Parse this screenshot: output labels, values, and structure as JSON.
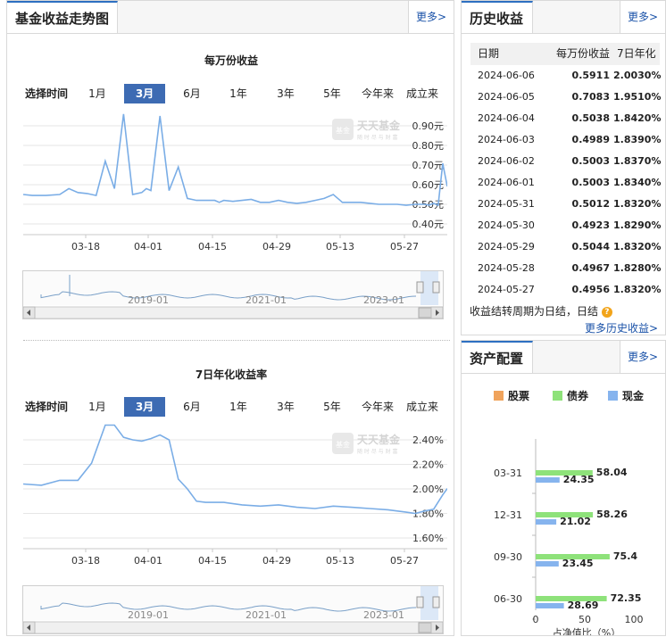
{
  "left": {
    "title": "基金收益走势图",
    "more": "更多>",
    "range_label": "选择时间",
    "ranges": [
      "1月",
      "3月",
      "6月",
      "1年",
      "3年",
      "5年",
      "今年来",
      "成立来"
    ],
    "selected_range": "3月",
    "watermark": {
      "name": "天天基金",
      "sub": "随 时 尽 与 财 富",
      "badge": "基金"
    },
    "nav_years": [
      "2019-01",
      "2021-01",
      "2023-01"
    ],
    "chart1_title": "每万份收益",
    "chart2_title": "7日年化收益率"
  },
  "history": {
    "title": "历史收益",
    "more": "更多>",
    "columns": [
      "日期",
      "每万份收益",
      "7日年化"
    ],
    "rows": [
      [
        "2024-06-06",
        "0.5911",
        "2.0030%"
      ],
      [
        "2024-06-05",
        "0.7083",
        "1.9510%"
      ],
      [
        "2024-06-04",
        "0.5038",
        "1.8420%"
      ],
      [
        "2024-06-03",
        "0.4989",
        "1.8390%"
      ],
      [
        "2024-06-02",
        "0.5003",
        "1.8370%"
      ],
      [
        "2024-06-01",
        "0.5003",
        "1.8340%"
      ],
      [
        "2024-05-31",
        "0.5012",
        "1.8320%"
      ],
      [
        "2024-05-30",
        "0.4923",
        "1.8290%"
      ],
      [
        "2024-05-29",
        "0.5044",
        "1.8320%"
      ],
      [
        "2024-05-28",
        "0.4967",
        "1.8280%"
      ],
      [
        "2024-05-27",
        "0.4956",
        "1.8320%"
      ]
    ],
    "note": "收益结转周期为日结，日结",
    "more_link": "更多历史收益>"
  },
  "assets": {
    "title": "资产配置",
    "more": "更多>",
    "xlabel": "占净值比（%）"
  },
  "chart_data": [
    {
      "id": "wanfen",
      "type": "line",
      "title": "每万份收益",
      "x_ticks": [
        "03-18",
        "04-01",
        "04-15",
        "04-29",
        "05-13",
        "05-27"
      ],
      "y_ticks": [
        "0.90元",
        "0.80元",
        "0.70元",
        "0.60元",
        "0.50元",
        "0.40元"
      ],
      "ylim": [
        0.4,
        0.9
      ],
      "xlim": [
        0,
        93
      ],
      "x": [
        0,
        2,
        5,
        8,
        10,
        12,
        14,
        16,
        18,
        20,
        22,
        24,
        26,
        27,
        28,
        30,
        32,
        34,
        36,
        37,
        38,
        40,
        42,
        43,
        44,
        46,
        48,
        50,
        52,
        54,
        56,
        58,
        60,
        62,
        64,
        66,
        68,
        70,
        72,
        74,
        76,
        78,
        80,
        82,
        84,
        86,
        88,
        89,
        90,
        91,
        92,
        93
      ],
      "values": [
        0.55,
        0.545,
        0.545,
        0.55,
        0.58,
        0.56,
        0.555,
        0.545,
        0.72,
        0.58,
        0.96,
        0.55,
        0.56,
        0.58,
        0.57,
        0.95,
        0.57,
        0.69,
        0.53,
        0.525,
        0.52,
        0.52,
        0.52,
        0.51,
        0.52,
        0.515,
        0.52,
        0.525,
        0.51,
        0.51,
        0.52,
        0.51,
        0.505,
        0.51,
        0.52,
        0.53,
        0.55,
        0.51,
        0.51,
        0.51,
        0.505,
        0.5,
        0.5,
        0.5,
        0.495,
        0.5,
        0.5,
        0.496,
        0.505,
        0.495,
        0.708,
        0.591
      ],
      "grid": true
    },
    {
      "id": "qiri",
      "type": "line",
      "title": "7日年化收益率",
      "x_ticks": [
        "03-18",
        "04-01",
        "04-15",
        "04-29",
        "05-13",
        "05-27"
      ],
      "y_ticks": [
        "2.40%",
        "2.20%",
        "2.00%",
        "1.80%",
        "1.60%"
      ],
      "ylim": [
        1.6,
        2.4
      ],
      "xlim": [
        0,
        93
      ],
      "x": [
        0,
        4,
        8,
        12,
        15,
        18,
        20,
        22,
        24,
        26,
        28,
        30,
        32,
        34,
        36,
        38,
        40,
        44,
        48,
        52,
        56,
        60,
        64,
        68,
        72,
        76,
        80,
        84,
        86,
        88,
        90,
        92,
        93
      ],
      "values": [
        2.04,
        2.03,
        2.07,
        2.07,
        2.21,
        2.52,
        2.52,
        2.42,
        2.4,
        2.39,
        2.41,
        2.44,
        2.4,
        2.08,
        2.0,
        1.9,
        1.89,
        1.89,
        1.87,
        1.86,
        1.87,
        1.85,
        1.84,
        1.86,
        1.85,
        1.84,
        1.83,
        1.81,
        1.8,
        1.82,
        1.834,
        1.951,
        2.003
      ],
      "grid": true
    },
    {
      "id": "asset",
      "type": "bar",
      "orientation": "horizontal",
      "categories": [
        "03-31",
        "12-31",
        "09-30",
        "06-30"
      ],
      "series": [
        {
          "name": "股票",
          "color": "#f0a35c",
          "values": [
            0,
            0,
            0,
            0
          ]
        },
        {
          "name": "债券",
          "color": "#8ee27a",
          "values": [
            58.04,
            58.26,
            75.4,
            72.35
          ]
        },
        {
          "name": "现金",
          "color": "#86b4ee",
          "values": [
            24.35,
            21.02,
            23.45,
            28.69
          ]
        }
      ],
      "x_ticks": [
        "0",
        "50",
        "100"
      ],
      "xlim": [
        0,
        100
      ],
      "xlabel": "占净值比（%）"
    }
  ]
}
